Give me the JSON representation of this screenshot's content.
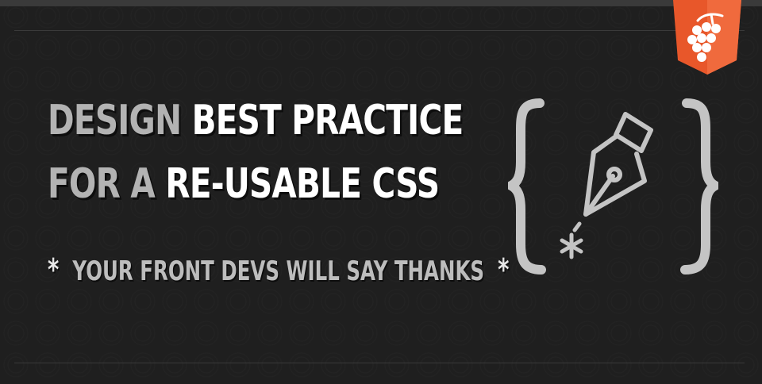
{
  "headline": {
    "line1_muted": "DESIGN",
    "line1_bright": "BEST PRACTICE",
    "line2_muted": "FOR A",
    "line2_bright": "RE-USABLE CSS"
  },
  "tagline": {
    "star_left": "*",
    "text": "YOUR FRONT DEVS WILL SAY THANKS",
    "star_right": "*"
  },
  "icons": {
    "emblem": "pen-nib-in-braces-icon",
    "badge": "grapes-shield-logo"
  },
  "colors": {
    "background": "#1f1f1f",
    "muted_text": "#b3b3b3",
    "bright_text": "#ffffff",
    "badge": "#e8572a"
  }
}
